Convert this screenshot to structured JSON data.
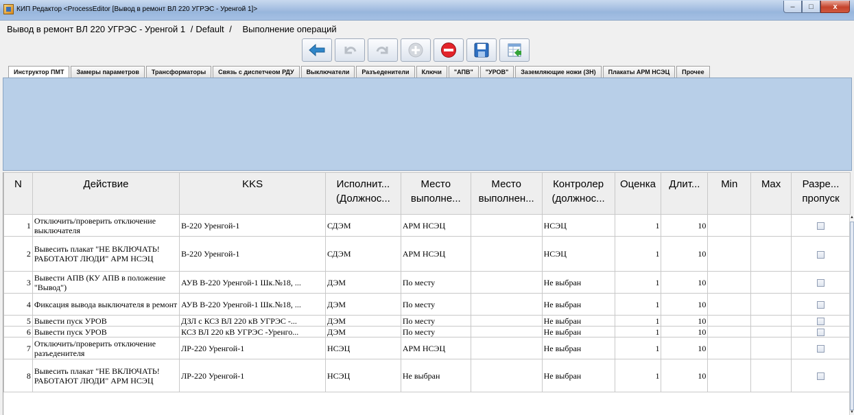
{
  "window": {
    "title": "КИП Редактор <ProcessEditor [Вывод в ремонт ВЛ 220 УГРЭС - Уренгой 1]>",
    "minimize": "–",
    "maximize": "□",
    "close": "x"
  },
  "header": {
    "operation": "Вывод в ремонт ВЛ 220 УГРЭС - Уренгой 1",
    "sep1": "/",
    "profile": "Default",
    "sep2": "/",
    "stage": "Выполнение операций"
  },
  "toolbar": {
    "buttons": [
      {
        "icon": "arrow-left-icon"
      },
      {
        "icon": "undo-icon"
      },
      {
        "icon": "redo-icon"
      },
      {
        "icon": "add-icon"
      },
      {
        "icon": "stop-icon"
      },
      {
        "icon": "save-icon"
      },
      {
        "icon": "export-icon"
      }
    ]
  },
  "tabs": [
    {
      "label": "Инструктор ПМТ",
      "active": true
    },
    {
      "label": "Замеры параметров"
    },
    {
      "label": "Трансформаторы"
    },
    {
      "label": "Связь с диспетчеом РДУ"
    },
    {
      "label": "Выключатели"
    },
    {
      "label": "Разъеденители"
    },
    {
      "label": "Ключи"
    },
    {
      "label": "\"АПВ\""
    },
    {
      "label": "\"УРОВ\""
    },
    {
      "label": "Заземляющие ножи (ЗН)"
    },
    {
      "label": "Плакаты АРМ НСЭЦ"
    },
    {
      "label": "Прочее"
    }
  ],
  "table": {
    "columns": [
      {
        "l1": "N",
        "l2": ""
      },
      {
        "l1": "Действие",
        "l2": ""
      },
      {
        "l1": "KKS",
        "l2": ""
      },
      {
        "l1": "Исполнит...",
        "l2": "(Должнос..."
      },
      {
        "l1": "Место",
        "l2": "выполне..."
      },
      {
        "l1": "Место",
        "l2": "выполнен..."
      },
      {
        "l1": "Контролер",
        "l2": "(должнос..."
      },
      {
        "l1": "Оценка",
        "l2": ""
      },
      {
        "l1": "Длит...",
        "l2": ""
      },
      {
        "l1": "Min",
        "l2": ""
      },
      {
        "l1": "Max",
        "l2": ""
      },
      {
        "l1": "Разре...",
        "l2": "пропуск"
      }
    ],
    "rows": [
      {
        "n": "1",
        "action": "Отключить/проверить отключение выключателя",
        "kks": "В-220 Уренгой-1",
        "executor": "СДЭМ",
        "place1": "АРМ НСЭЦ",
        "place2": "",
        "controller": "НСЭЦ",
        "score": "1",
        "dur": "10",
        "min": "",
        "max": "",
        "allow": false
      },
      {
        "n": "2",
        "action": "Вывесить плакат \"НЕ ВКЛЮЧАТЬ! РАБОТАЮТ ЛЮДИ\" АРМ НСЭЦ",
        "kks": "В-220 Уренгой-1",
        "executor": "СДЭМ",
        "place1": "АРМ НСЭЦ",
        "place2": "",
        "controller": "НСЭЦ",
        "score": "1",
        "dur": "10",
        "min": "",
        "max": "",
        "allow": false
      },
      {
        "n": "3",
        "action": "Вывести АПВ  (КУ АПВ в положение \"Вывод\")",
        "kks": "АУВ В-220 Уренгой-1 Шк.№18, ...",
        "executor": "ДЭМ",
        "place1": "По месту",
        "place2": "",
        "controller": "Не выбран",
        "score": "1",
        "dur": "10",
        "min": "",
        "max": "",
        "allow": false
      },
      {
        "n": "4",
        "action": "Фиксация вывода выключателя в ремонт",
        "kks": "АУВ В-220 Уренгой-1 Шк.№18, ...",
        "executor": "ДЭМ",
        "place1": "По месту",
        "place2": "",
        "controller": "Не выбран",
        "score": "1",
        "dur": "10",
        "min": "",
        "max": "",
        "allow": false
      },
      {
        "n": "5",
        "action": "Вывести пуск УРОВ",
        "kks": "ДЗЛ с КСЗ ВЛ 220 кВ УГРЭС -...",
        "executor": "ДЭМ",
        "place1": "По месту",
        "place2": "",
        "controller": "Не выбран",
        "score": "1",
        "dur": "10",
        "min": "",
        "max": "",
        "allow": false
      },
      {
        "n": "6",
        "action": "Вывести пуск УРОВ",
        "kks": "КСЗ ВЛ 220 кВ УГРЭС -Уренго...",
        "executor": "ДЭМ",
        "place1": "По месту",
        "place2": "",
        "controller": "Не выбран",
        "score": "1",
        "dur": "10",
        "min": "",
        "max": "",
        "allow": false
      },
      {
        "n": "7",
        "action": "Отключить/проверить отключение разъеденителя",
        "kks": "ЛР-220 Уренгой-1",
        "executor": "НСЭЦ",
        "place1": "АРМ НСЭЦ",
        "place2": "",
        "controller": "Не выбран",
        "score": "1",
        "dur": "10",
        "min": "",
        "max": "",
        "allow": false
      },
      {
        "n": "8",
        "action": "Вывесить плакат \"НЕ ВКЛЮЧАТЬ! РАБОТАЮТ ЛЮДИ\" АРМ НСЭЦ",
        "kks": "ЛР-220 Уренгой-1",
        "executor": "НСЭЦ",
        "place1": "Не выбран",
        "place2": "",
        "controller": "Не выбран",
        "score": "1",
        "dur": "10",
        "min": "",
        "max": "",
        "allow": false
      }
    ]
  }
}
